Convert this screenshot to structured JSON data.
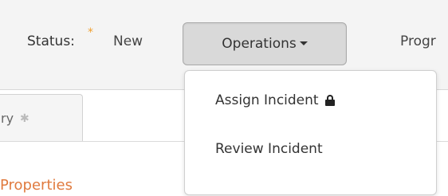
{
  "header": {
    "status_label": "Status:",
    "required_star": "*",
    "status_value": "New",
    "operations_label": "Operations",
    "progress_label_truncated": "Progr"
  },
  "tabs": [
    {
      "label_truncated": "ry",
      "required_star": "✱"
    }
  ],
  "section": {
    "title": "Properties"
  },
  "operations_menu": {
    "items": [
      {
        "label": "Assign Incident",
        "icon": "lock-icon"
      },
      {
        "label": "Review Incident"
      }
    ]
  },
  "colors": {
    "accent_star": "#f0a030",
    "section_title": "#e07a3e"
  }
}
